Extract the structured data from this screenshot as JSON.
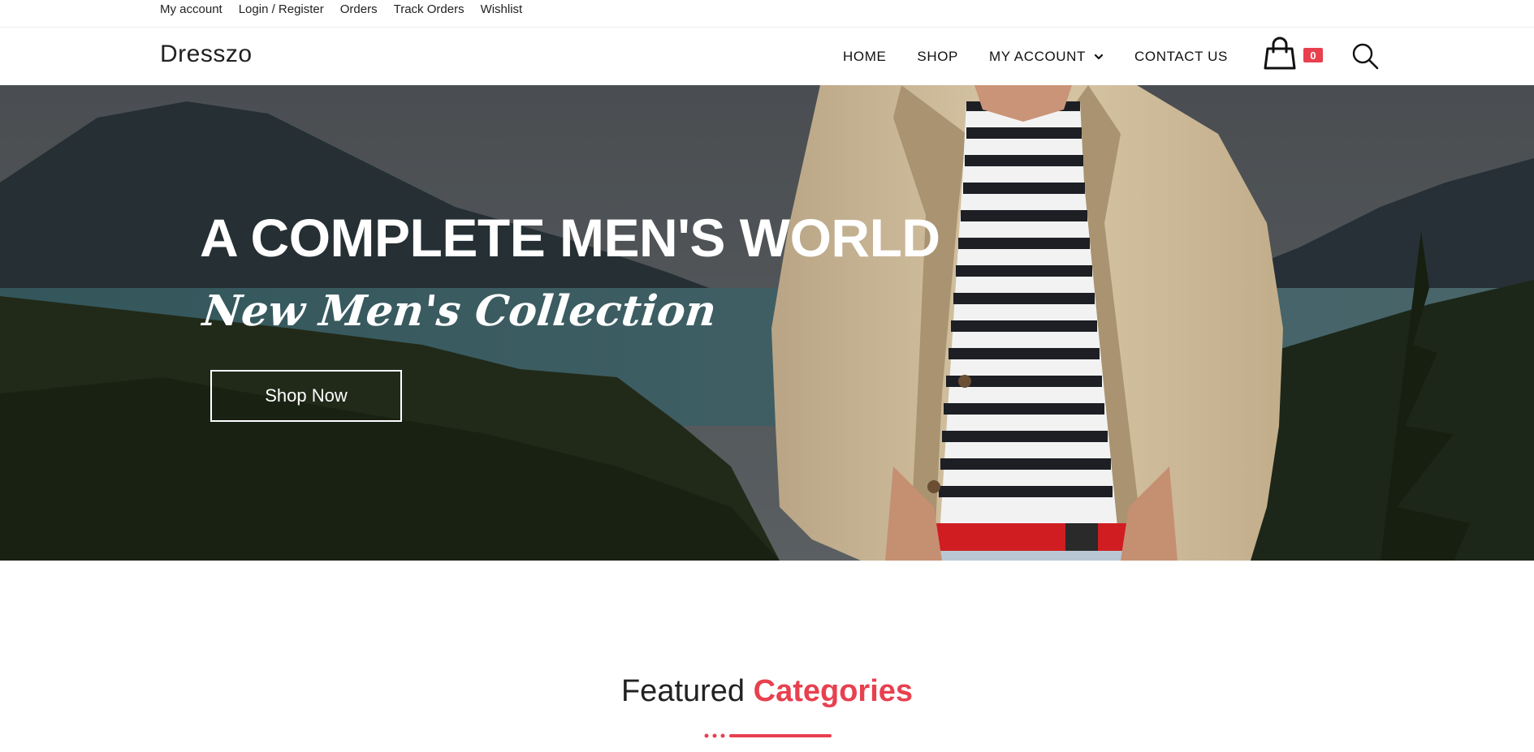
{
  "topbar": {
    "links": [
      "My account",
      "Login / Register",
      "Orders",
      "Track Orders",
      "Wishlist"
    ]
  },
  "header": {
    "logo": "Dresszo",
    "menu": [
      "HOME",
      "SHOP",
      "MY ACCOUNT",
      "CONTACT US"
    ],
    "cart_count": "0"
  },
  "hero": {
    "title": "A COMPLETE MEN'S WORLD",
    "subtitle": "New Men's Collection",
    "button": "Shop Now"
  },
  "featured": {
    "title_plain": "Featured",
    "title_accent": "Categories"
  },
  "icons": {
    "cart": "shopping-bag-icon",
    "search": "search-icon",
    "dropdown": "chevron-down-icon"
  },
  "colors": {
    "accent": "#e8404f",
    "text": "#222222"
  }
}
